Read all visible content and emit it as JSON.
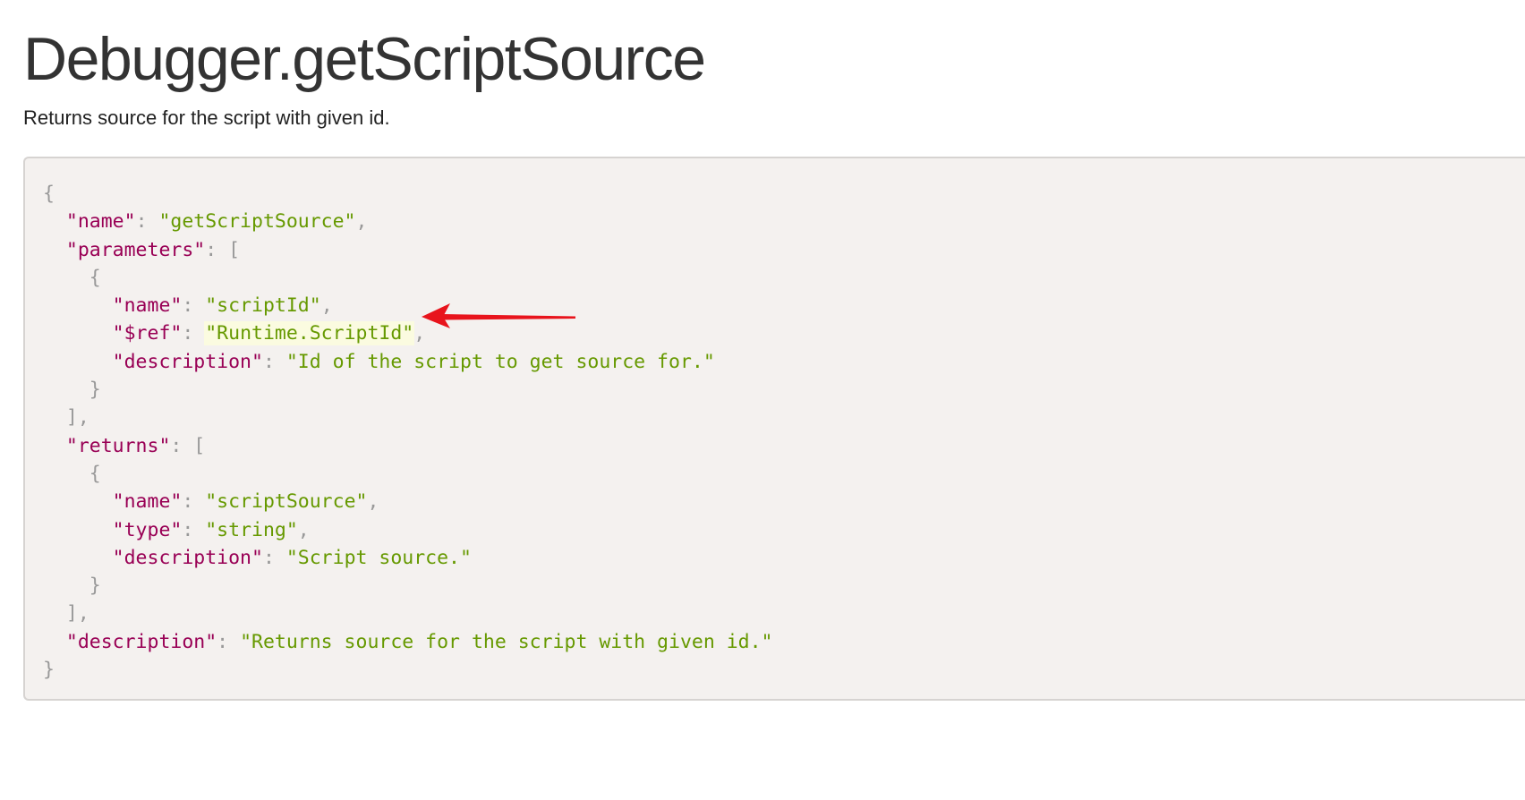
{
  "page": {
    "title": "Debugger.getScriptSource",
    "description": "Returns source for the script with given id."
  },
  "colors": {
    "key": "#990055",
    "string": "#669900",
    "punctuation": "#999999",
    "annotation_arrow": "#e8141c",
    "code_background": "#f4f1ef"
  },
  "code": {
    "lines": [
      [
        {
          "t": "p",
          "v": "{"
        }
      ],
      [
        {
          "t": "w",
          "v": "  "
        },
        {
          "t": "k",
          "v": "\"name\""
        },
        {
          "t": "p",
          "v": ": "
        },
        {
          "t": "s",
          "v": "\"getScriptSource\""
        },
        {
          "t": "p",
          "v": ","
        }
      ],
      [
        {
          "t": "w",
          "v": "  "
        },
        {
          "t": "k",
          "v": "\"parameters\""
        },
        {
          "t": "p",
          "v": ": ["
        }
      ],
      [
        {
          "t": "w",
          "v": "    "
        },
        {
          "t": "p",
          "v": "{"
        }
      ],
      [
        {
          "t": "w",
          "v": "      "
        },
        {
          "t": "k",
          "v": "\"name\""
        },
        {
          "t": "p",
          "v": ": "
        },
        {
          "t": "s",
          "v": "\"scriptId\""
        },
        {
          "t": "p",
          "v": ","
        }
      ],
      [
        {
          "t": "w",
          "v": "      "
        },
        {
          "t": "k",
          "v": "\"$ref\""
        },
        {
          "t": "p",
          "v": ": "
        },
        {
          "t": "s",
          "v": "\"Runtime.ScriptId\"",
          "hl": true
        },
        {
          "t": "p",
          "v": ","
        }
      ],
      [
        {
          "t": "w",
          "v": "      "
        },
        {
          "t": "k",
          "v": "\"description\""
        },
        {
          "t": "p",
          "v": ": "
        },
        {
          "t": "s",
          "v": "\"Id of the script to get source for.\""
        }
      ],
      [
        {
          "t": "w",
          "v": "    "
        },
        {
          "t": "p",
          "v": "}"
        }
      ],
      [
        {
          "t": "w",
          "v": "  "
        },
        {
          "t": "p",
          "v": "],"
        }
      ],
      [
        {
          "t": "w",
          "v": "  "
        },
        {
          "t": "k",
          "v": "\"returns\""
        },
        {
          "t": "p",
          "v": ": ["
        }
      ],
      [
        {
          "t": "w",
          "v": "    "
        },
        {
          "t": "p",
          "v": "{"
        }
      ],
      [
        {
          "t": "w",
          "v": "      "
        },
        {
          "t": "k",
          "v": "\"name\""
        },
        {
          "t": "p",
          "v": ": "
        },
        {
          "t": "s",
          "v": "\"scriptSource\""
        },
        {
          "t": "p",
          "v": ","
        }
      ],
      [
        {
          "t": "w",
          "v": "      "
        },
        {
          "t": "k",
          "v": "\"type\""
        },
        {
          "t": "p",
          "v": ": "
        },
        {
          "t": "s",
          "v": "\"string\""
        },
        {
          "t": "p",
          "v": ","
        }
      ],
      [
        {
          "t": "w",
          "v": "      "
        },
        {
          "t": "k",
          "v": "\"description\""
        },
        {
          "t": "p",
          "v": ": "
        },
        {
          "t": "s",
          "v": "\"Script source.\""
        }
      ],
      [
        {
          "t": "w",
          "v": "    "
        },
        {
          "t": "p",
          "v": "}"
        }
      ],
      [
        {
          "t": "w",
          "v": "  "
        },
        {
          "t": "p",
          "v": "],"
        }
      ],
      [
        {
          "t": "w",
          "v": "  "
        },
        {
          "t": "k",
          "v": "\"description\""
        },
        {
          "t": "p",
          "v": ": "
        },
        {
          "t": "s",
          "v": "\"Returns source for the script with given id.\""
        }
      ],
      [
        {
          "t": "p",
          "v": "}"
        }
      ]
    ]
  }
}
